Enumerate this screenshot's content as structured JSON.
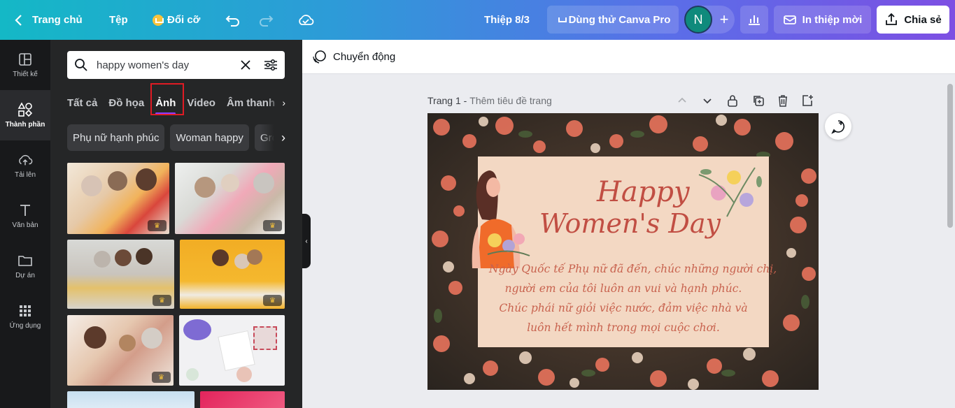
{
  "topbar": {
    "home_label": "Trang chủ",
    "file_label": "Tệp",
    "resize_label": "Đổi cỡ",
    "doc_title": "Thiệp 8/3",
    "try_pro_label": "Dùng thử Canva Pro",
    "avatar_letter": "N",
    "print_label": "In thiệp mời",
    "share_label": "Chia sẻ"
  },
  "rail": {
    "items": [
      {
        "label": "Thiết kế",
        "icon": "layout-icon"
      },
      {
        "label": "Thành phần",
        "icon": "shapes-icon"
      },
      {
        "label": "Tải lên",
        "icon": "cloud-upload-icon"
      },
      {
        "label": "Văn bản",
        "icon": "text-icon"
      },
      {
        "label": "Dự án",
        "icon": "folder-icon"
      },
      {
        "label": "Ứng dụng",
        "icon": "apps-grid-icon"
      }
    ]
  },
  "panel": {
    "search_value": "happy women's day",
    "tabs": [
      "Tất cả",
      "Đồ họa",
      "Ảnh",
      "Video",
      "Âm thanh"
    ],
    "active_tab": "Ảnh",
    "chips": [
      "Phụ nữ hạnh phúc",
      "Woman happy",
      "Group"
    ]
  },
  "toolbar": {
    "animate_label": "Chuyển động"
  },
  "page": {
    "label": "Trang 1 -",
    "title_placeholder": "Thêm tiêu đề trang"
  },
  "design": {
    "title_line1": "Happy",
    "title_line2": "Women's Day",
    "message": [
      "Ngày Quốc tế Phụ nữ đã đến, chúc những người chị,",
      "người em của tôi luôn an vui và hạnh phúc.",
      "Chúc phái nữ giỏi việc nước, đảm việc nhà và",
      "luôn hết mình trong mọi cuộc chơi."
    ]
  },
  "colors": {
    "accent": "#8b3dff",
    "highlight_box": "#e01b24",
    "title_text": "#c14e43",
    "card_bg": "#f3d8c3"
  }
}
